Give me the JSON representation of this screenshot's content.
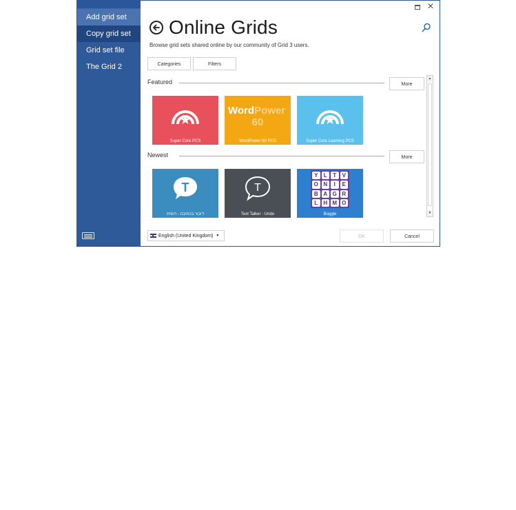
{
  "sidebar": {
    "items": [
      {
        "label": "Add grid set"
      },
      {
        "label": "Copy grid set"
      },
      {
        "label": "Grid set file"
      },
      {
        "label": "The Grid 2"
      }
    ]
  },
  "header": {
    "title": "Online Grids",
    "subtitle": "Browse grid sets shared online by our community of Grid 3 users."
  },
  "filters": {
    "categories_label": "Categories",
    "filters_label": "Filters"
  },
  "featured": {
    "label": "Featured",
    "more_label": "More",
    "tiles": [
      {
        "caption": "Super Core PCS",
        "color": "#e8505b"
      },
      {
        "caption": "WordPower 60 PCS",
        "color": "#f3a712",
        "logo_word": "Word",
        "logo_power": "Power",
        "logo_num": "60"
      },
      {
        "caption": "Super Core Learning PCS",
        "color": "#5bc0eb"
      }
    ]
  },
  "newest": {
    "label": "Newest",
    "more_label": "More",
    "tiles": [
      {
        "caption": "דיבור בכתיבה - רוסית",
        "color": "#3b8dc0",
        "icon_letter": "T"
      },
      {
        "caption": "Text Talker  - Undo",
        "color": "#4a4f55",
        "icon_letter": "T"
      },
      {
        "caption": "Boggle",
        "color": "#2f7fd0",
        "letters": [
          "Y",
          "L",
          "T",
          "V",
          "O",
          "N",
          "I",
          "E",
          "B",
          "A",
          "G",
          "R",
          "L",
          "H",
          "M",
          "O"
        ]
      }
    ]
  },
  "footer": {
    "language": "English (United Kingdom)",
    "ok_label": "OK",
    "cancel_label": "Cancel"
  }
}
